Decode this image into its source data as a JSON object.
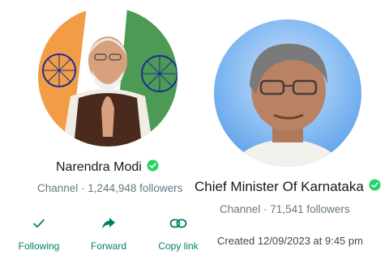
{
  "channel1": {
    "name": "Narendra Modi",
    "type": "Channel",
    "followers": "1,244,948 followers",
    "verified_icon": "verified-badge-icon"
  },
  "channel2": {
    "name": "Chief Minister Of Karnataka",
    "type": "Channel",
    "followers": "71,541 followers",
    "created": "Created 12/09/2023 at 9:45 pm",
    "verified_icon": "verified-badge-icon"
  },
  "separator": " · ",
  "actions": [
    {
      "label": "Following",
      "icon": "check-icon"
    },
    {
      "label": "Forward",
      "icon": "forward-arrow-icon"
    },
    {
      "label": "Copy link",
      "icon": "link-icon"
    }
  ],
  "colors": {
    "accent": "#008069",
    "verified": "#25d366",
    "text_primary": "#111b21",
    "text_secondary": "#667781"
  }
}
